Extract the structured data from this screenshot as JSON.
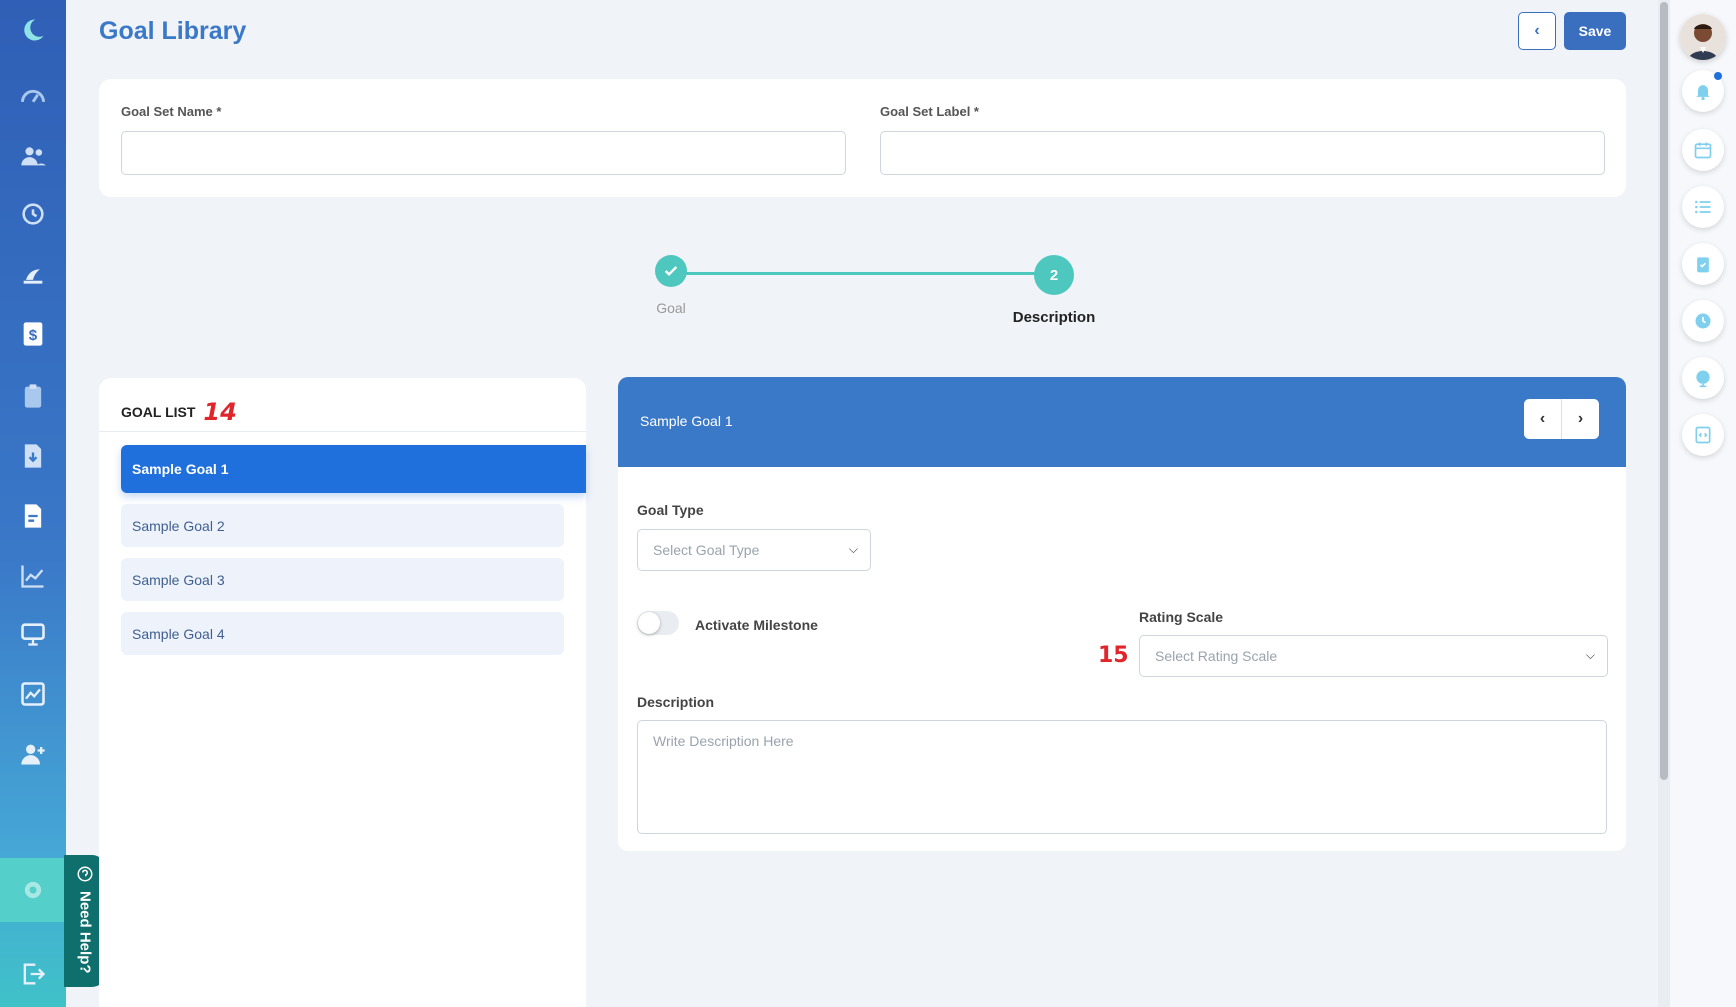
{
  "header": {
    "title": "Goal Library",
    "save_label": "Save"
  },
  "form": {
    "goal_set_name_label": "Goal Set Name *",
    "goal_set_label_label": "Goal Set Label *",
    "goal_set_name_value": "",
    "goal_set_label_value": ""
  },
  "stepper": {
    "steps": [
      {
        "label": "Goal",
        "state": "completed"
      },
      {
        "label": "Description",
        "number": "2",
        "state": "active"
      }
    ]
  },
  "goal_list": {
    "heading": "GOAL LIST",
    "annotation": "14",
    "items": [
      {
        "label": "Sample Goal 1",
        "active": true
      },
      {
        "label": "Sample Goal 2",
        "active": false
      },
      {
        "label": "Sample Goal 3",
        "active": false
      },
      {
        "label": "Sample Goal 4",
        "active": false
      }
    ]
  },
  "detail": {
    "title": "Sample Goal 1",
    "goal_type_label": "Goal Type",
    "goal_type_placeholder": "Select Goal Type",
    "milestone_label": "Activate Milestone",
    "milestone_on": false,
    "rating_scale_label": "Rating Scale",
    "rating_scale_placeholder": "Select Rating Scale",
    "annotation": "15",
    "description_label": "Description",
    "description_placeholder": "Write Description Here"
  },
  "need_help": {
    "label": "Need Help?"
  },
  "colors": {
    "primary": "#3a78c8",
    "accent": "#4ec7bf",
    "active_item": "#1f6fdc",
    "annotation": "#e0262b"
  },
  "sidebar_icons": [
    "logo-moon-icon",
    "dashboard-gauge-icon",
    "people-icon",
    "history-clock-icon",
    "vacation-icon",
    "payroll-dollar-icon",
    "clipboard-icon",
    "document-download-icon",
    "document-text-icon",
    "analytics-chart-icon",
    "presentation-icon",
    "image-chart-icon",
    "add-user-icon",
    "settings-gear-icon",
    "logout-icon"
  ],
  "rail_icons": [
    "avatar",
    "bell-icon",
    "calendar-icon",
    "list-icon",
    "clipboard-check-icon",
    "clock-icon",
    "globe-icon",
    "code-document-icon"
  ]
}
